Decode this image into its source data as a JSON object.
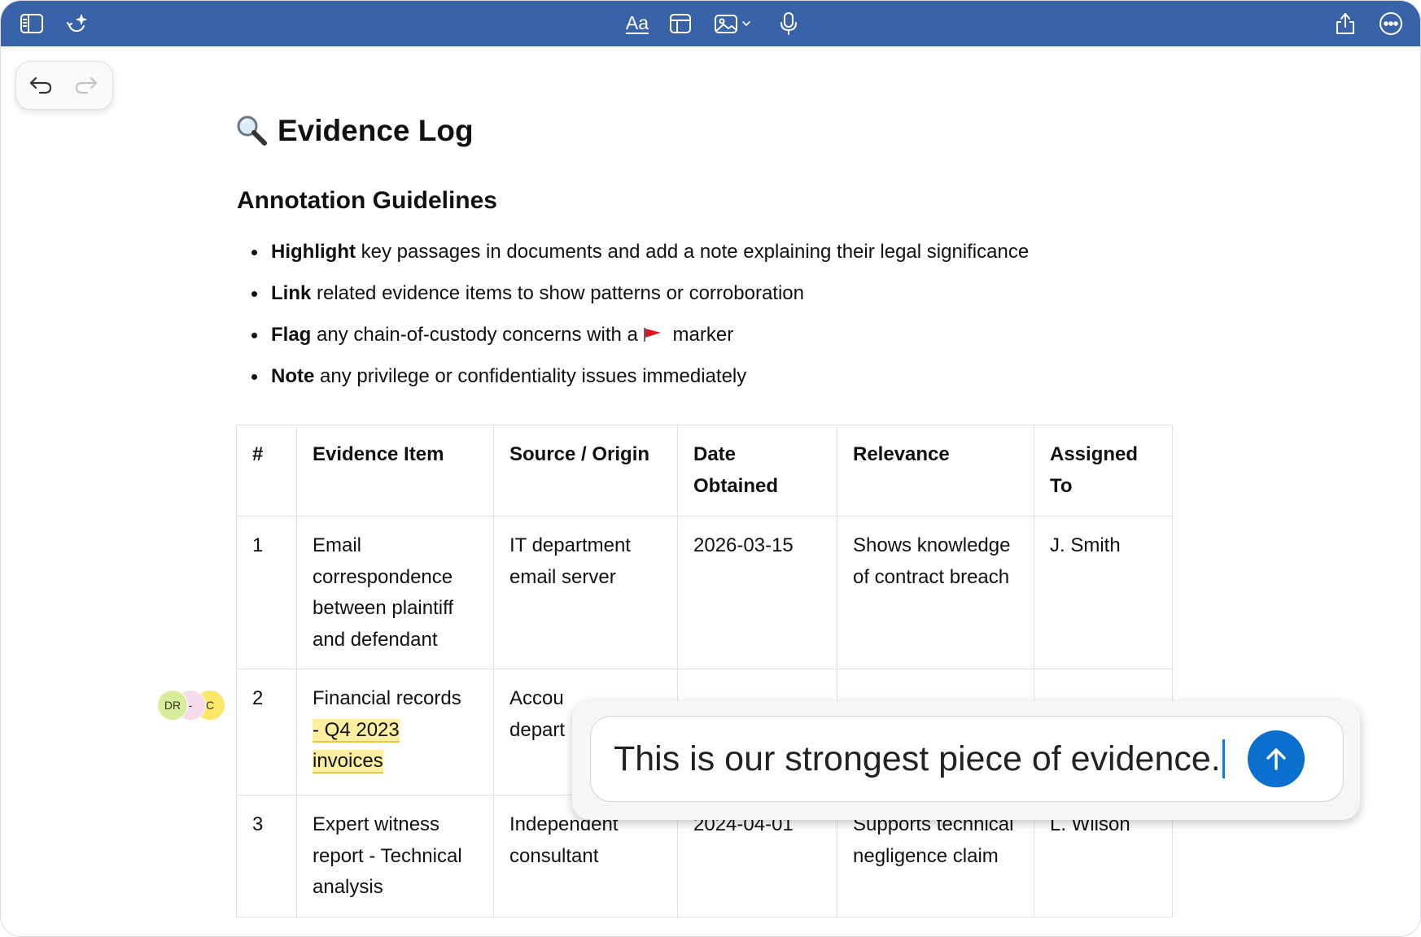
{
  "toolbar": {
    "left_icons": [
      "sidebar-icon",
      "ai-assist-icon"
    ],
    "center_icons": [
      "text-format-icon",
      "table-icon",
      "image-icon",
      "microphone-icon"
    ],
    "right_icons": [
      "share-icon",
      "more-icon"
    ],
    "text_format_label": "Aa",
    "background_color": "#3863a9"
  },
  "document": {
    "title": "Evidence Log",
    "title_icon": "magnifying-glass-icon",
    "section_heading": "Annotation Guidelines",
    "guidelines": [
      {
        "bold": "Highlight",
        "text": " key passages in documents and add a note explaining their legal significance"
      },
      {
        "bold": "Link",
        "text": " related evidence items to show patterns or corroboration"
      },
      {
        "bold": "Flag",
        "text": " any chain-of-custody concerns with a",
        "after_flag": " marker"
      },
      {
        "bold": "Note",
        "text": " any privilege or confidentiality issues immediately"
      }
    ]
  },
  "table": {
    "headers": [
      "#",
      "Evidence Item",
      "Source / Origin",
      "Date Obtained",
      "Relevance",
      "Assigned To"
    ],
    "rows": [
      {
        "num": "1",
        "item": "Email correspondence between plaintiff and defendant",
        "source": "IT department email server",
        "date": "2026-03-15",
        "relevance": "Shows knowledge of contract breach",
        "assigned": "J. Smith"
      },
      {
        "num": "2",
        "item_line1": "Financial records",
        "item_highlight_1": "- Q4 2023",
        "item_highlight_2": "invoices",
        "source": "Accou",
        "source_line2": "depart",
        "date": "",
        "relevance": "",
        "assigned": ""
      },
      {
        "num": "3",
        "item": "Expert witness report - Technical analysis",
        "source": "Independent consultant",
        "date": "2024-04-01",
        "relevance": "Supports technical negligence claim",
        "assigned": "L. Wilson"
      }
    ]
  },
  "collaborators": [
    {
      "initials": "DR",
      "color": "#d8ed9c"
    },
    {
      "initials": "-",
      "color": "#f6dcea"
    },
    {
      "initials": "C",
      "color": "#fde66a"
    }
  ],
  "comment": {
    "text": "This is our strongest piece of evidence.",
    "send_color": "#0b6fcf"
  }
}
